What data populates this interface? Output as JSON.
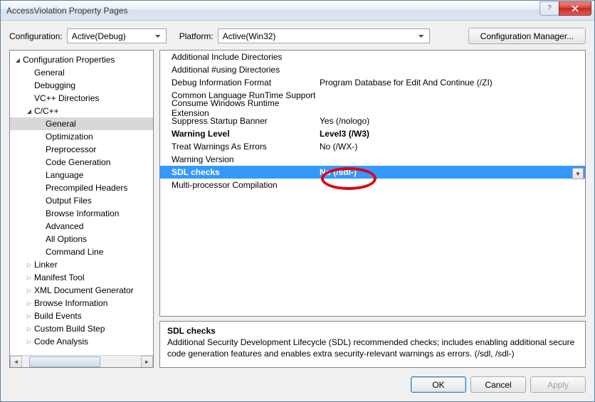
{
  "window": {
    "title": "AccessViolation Property Pages"
  },
  "toolbar": {
    "config_label": "Configuration:",
    "config_value": "Active(Debug)",
    "platform_label": "Platform:",
    "platform_value": "Active(Win32)",
    "config_manager": "Configuration Manager..."
  },
  "tree": [
    {
      "label": "Configuration Properties",
      "indent": 0,
      "arrow": "open"
    },
    {
      "label": "General",
      "indent": 1,
      "arrow": "none"
    },
    {
      "label": "Debugging",
      "indent": 1,
      "arrow": "none"
    },
    {
      "label": "VC++ Directories",
      "indent": 1,
      "arrow": "none"
    },
    {
      "label": "C/C++",
      "indent": 1,
      "arrow": "open"
    },
    {
      "label": "General",
      "indent": 2,
      "arrow": "none",
      "selected": true
    },
    {
      "label": "Optimization",
      "indent": 2,
      "arrow": "none"
    },
    {
      "label": "Preprocessor",
      "indent": 2,
      "arrow": "none"
    },
    {
      "label": "Code Generation",
      "indent": 2,
      "arrow": "none"
    },
    {
      "label": "Language",
      "indent": 2,
      "arrow": "none"
    },
    {
      "label": "Precompiled Headers",
      "indent": 2,
      "arrow": "none"
    },
    {
      "label": "Output Files",
      "indent": 2,
      "arrow": "none"
    },
    {
      "label": "Browse Information",
      "indent": 2,
      "arrow": "none"
    },
    {
      "label": "Advanced",
      "indent": 2,
      "arrow": "none"
    },
    {
      "label": "All Options",
      "indent": 2,
      "arrow": "none"
    },
    {
      "label": "Command Line",
      "indent": 2,
      "arrow": "none"
    },
    {
      "label": "Linker",
      "indent": 1,
      "arrow": "closed"
    },
    {
      "label": "Manifest Tool",
      "indent": 1,
      "arrow": "closed"
    },
    {
      "label": "XML Document Generator",
      "indent": 1,
      "arrow": "closed"
    },
    {
      "label": "Browse Information",
      "indent": 1,
      "arrow": "closed"
    },
    {
      "label": "Build Events",
      "indent": 1,
      "arrow": "closed"
    },
    {
      "label": "Custom Build Step",
      "indent": 1,
      "arrow": "closed"
    },
    {
      "label": "Code Analysis",
      "indent": 1,
      "arrow": "closed"
    }
  ],
  "grid": [
    {
      "name": "Additional Include Directories",
      "value": ""
    },
    {
      "name": "Additional #using Directories",
      "value": ""
    },
    {
      "name": "Debug Information Format",
      "value": "Program Database for Edit And Continue (/ZI)"
    },
    {
      "name": "Common Language RunTime Support",
      "value": ""
    },
    {
      "name": "Consume Windows Runtime Extension",
      "value": ""
    },
    {
      "name": "Suppress Startup Banner",
      "value": "Yes (/nologo)"
    },
    {
      "name": "Warning Level",
      "value": "Level3 (/W3)",
      "bold": true
    },
    {
      "name": "Treat Warnings As Errors",
      "value": "No (/WX-)"
    },
    {
      "name": "Warning Version",
      "value": ""
    },
    {
      "name": "SDL checks",
      "value": "No (/sdl-)",
      "selected": true
    },
    {
      "name": "Multi-processor Compilation",
      "value": ""
    }
  ],
  "description": {
    "title": "SDL checks",
    "body": "Additional Security Development Lifecycle (SDL) recommended checks; includes enabling additional secure code generation features and enables extra security-relevant warnings as errors.     (/sdl, /sdl-)"
  },
  "footer": {
    "ok": "OK",
    "cancel": "Cancel",
    "apply": "Apply"
  }
}
